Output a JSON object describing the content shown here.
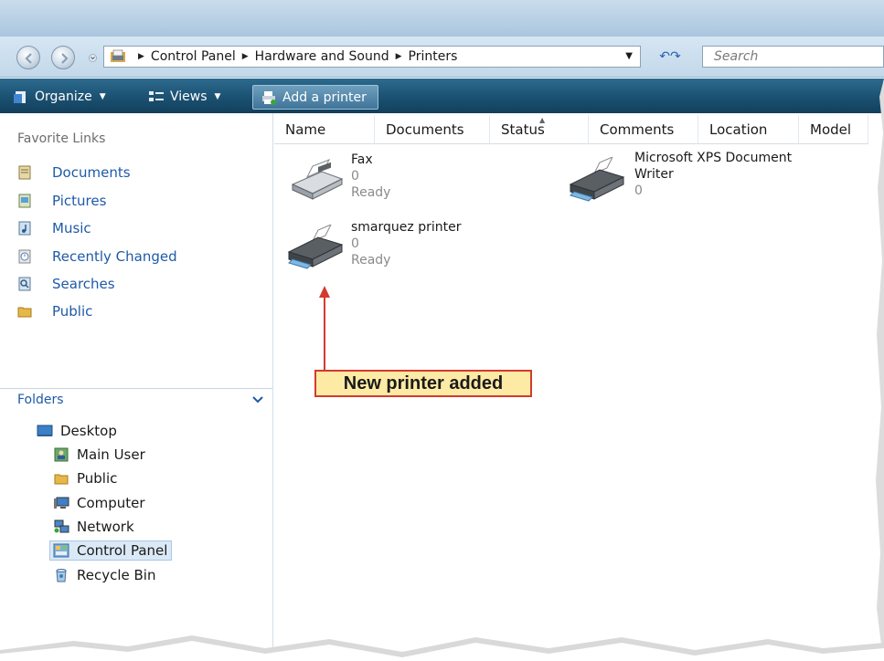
{
  "address": {
    "crumbs": [
      "Control Panel",
      "Hardware and Sound",
      "Printers"
    ]
  },
  "search": {
    "placeholder": "Search"
  },
  "toolbar": {
    "organize": "Organize",
    "views": "Views",
    "add_printer": "Add a printer"
  },
  "sidebar": {
    "favorites_title": "Favorite Links",
    "items": [
      {
        "label": "Documents",
        "icon": "documents-icon"
      },
      {
        "label": "Pictures",
        "icon": "pictures-icon"
      },
      {
        "label": "Music",
        "icon": "music-icon"
      },
      {
        "label": "Recently Changed",
        "icon": "recently-changed-icon"
      },
      {
        "label": "Searches",
        "icon": "searches-icon"
      },
      {
        "label": "Public",
        "icon": "public-folder-icon"
      }
    ],
    "folders_title": "Folders",
    "tree": [
      {
        "label": "Desktop",
        "icon": "desktop-icon"
      },
      {
        "label": "Main User",
        "icon": "user-folder-icon"
      },
      {
        "label": "Public",
        "icon": "public-folder-icon"
      },
      {
        "label": "Computer",
        "icon": "computer-icon"
      },
      {
        "label": "Network",
        "icon": "network-icon"
      },
      {
        "label": "Control Panel",
        "icon": "control-panel-icon",
        "selected": true
      },
      {
        "label": "Recycle Bin",
        "icon": "recycle-bin-icon"
      }
    ]
  },
  "columns": [
    "Name",
    "Documents",
    "Status",
    "Comments",
    "Location",
    "Model"
  ],
  "printers": [
    {
      "name": "Fax",
      "documents": "0",
      "status": "Ready",
      "icon": "fax-icon"
    },
    {
      "name_line1": "Microsoft XPS Document",
      "name_line2": "Writer",
      "documents": "0",
      "icon": "printer-icon"
    },
    {
      "name": "smarquez printer",
      "documents": "0",
      "status": "Ready",
      "icon": "printer-icon"
    }
  ],
  "annotation": {
    "text": "New printer added"
  },
  "colors": {
    "toolbar": "#1c5374",
    "link": "#1e5aa8",
    "callout_bg": "#fdeaa4",
    "callout_border": "#d43a2f"
  }
}
